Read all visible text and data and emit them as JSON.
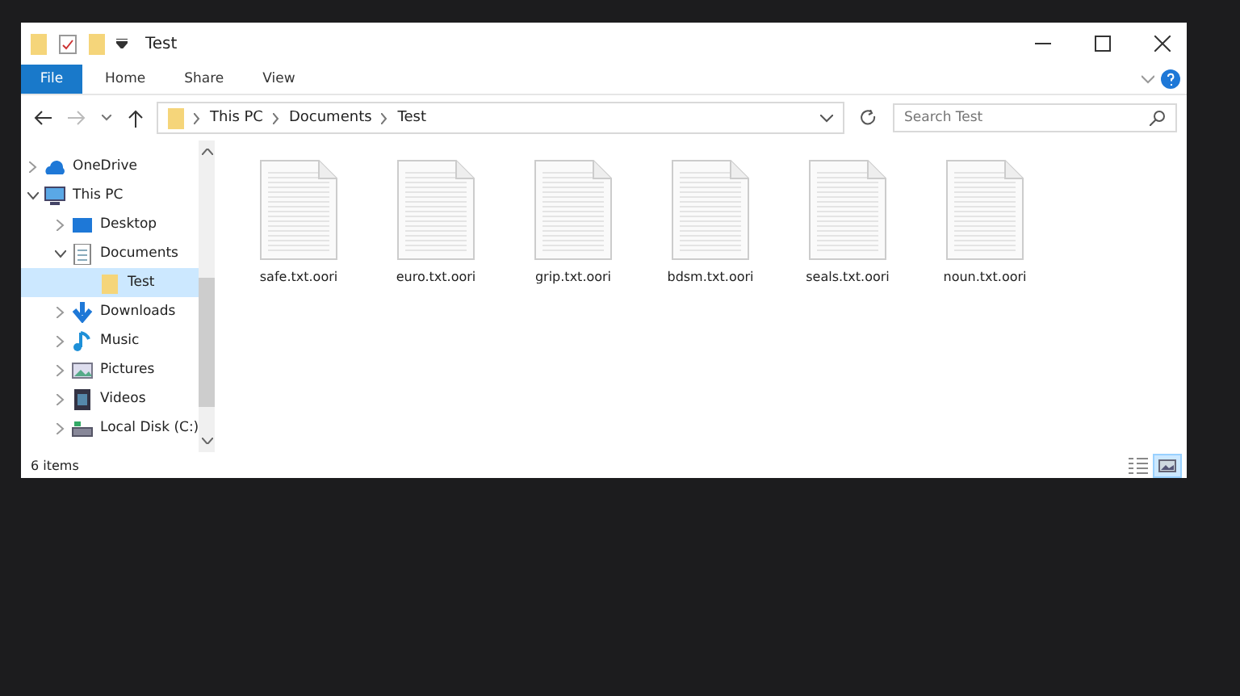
{
  "window": {
    "title": "Test"
  },
  "ribbon_tabs": [
    {
      "label": "File",
      "kind": "file"
    },
    {
      "label": "Home",
      "kind": "tab"
    },
    {
      "label": "Share",
      "kind": "tab"
    },
    {
      "label": "View",
      "kind": "tab"
    }
  ],
  "address_bar": {
    "breadcrumbs": [
      "This PC",
      "Documents",
      "Test"
    ]
  },
  "search": {
    "placeholder": "Search Test"
  },
  "nav_tree": [
    {
      "label": "OneDrive",
      "kind": "onedrive",
      "expanded": false,
      "selected": false
    },
    {
      "label": "This PC",
      "kind": "pc",
      "expanded": true,
      "selected": false,
      "children": [
        {
          "label": "Desktop",
          "kind": "desktop",
          "expanded": false,
          "selected": false
        },
        {
          "label": "Documents",
          "kind": "documents",
          "expanded": true,
          "selected": false,
          "children": [
            {
              "label": "Test",
              "kind": "folder",
              "selected": true
            }
          ]
        },
        {
          "label": "Downloads",
          "kind": "downloads",
          "expanded": false,
          "selected": false
        },
        {
          "label": "Music",
          "kind": "music",
          "expanded": false,
          "selected": false
        },
        {
          "label": "Pictures",
          "kind": "pictures",
          "expanded": false,
          "selected": false
        },
        {
          "label": "Videos",
          "kind": "videos",
          "expanded": false,
          "selected": false
        },
        {
          "label": "Local Disk (C:)",
          "kind": "drive",
          "expanded": false,
          "selected": false
        }
      ]
    }
  ],
  "files": [
    {
      "name": "safe.txt.oori"
    },
    {
      "name": "euro.txt.oori"
    },
    {
      "name": "grip.txt.oori"
    },
    {
      "name": "bdsm.txt.oori"
    },
    {
      "name": "seals.txt.oori"
    },
    {
      "name": "noun.txt.oori"
    }
  ],
  "status_bar": {
    "item_count": "6 items"
  },
  "view_buttons": [
    {
      "kind": "details",
      "selected": false
    },
    {
      "kind": "large-icons",
      "selected": true
    }
  ]
}
